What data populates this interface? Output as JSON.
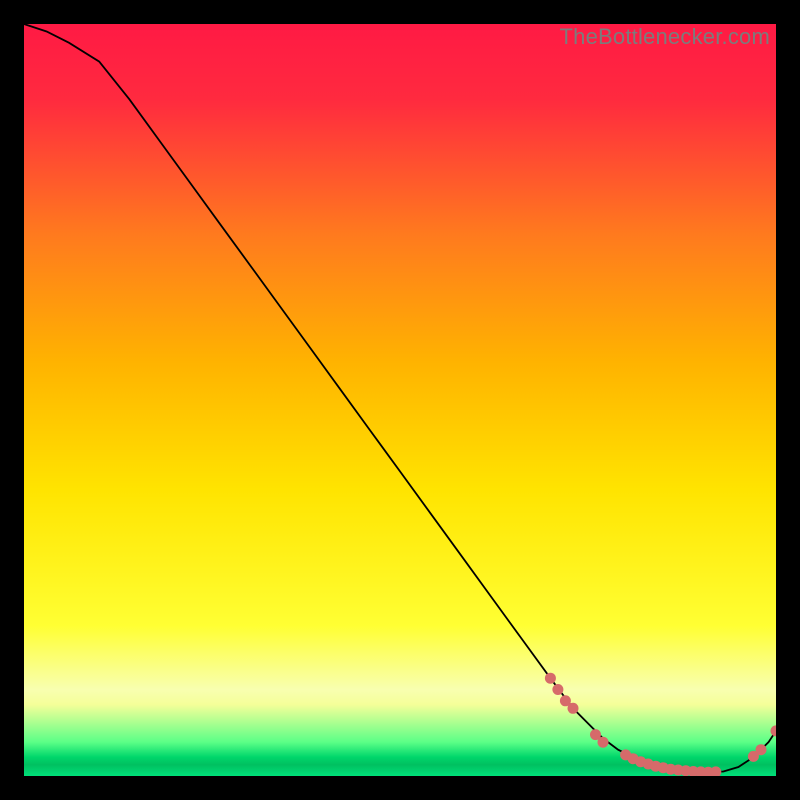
{
  "watermark": "TheBottlenecker.com",
  "chart_data": {
    "type": "line",
    "title": "",
    "xlabel": "",
    "ylabel": "",
    "xlim": [
      0,
      100
    ],
    "ylim": [
      0,
      100
    ],
    "background_gradient": {
      "top": "#ff1a44",
      "mid_top": "#ff9a00",
      "mid": "#ffe400",
      "mid_low": "#ffff66",
      "low_band_top": "#f5ff99",
      "green": "#00d66b"
    },
    "series": [
      {
        "name": "bottleneck-curve",
        "x": [
          0,
          3,
          6,
          10,
          14,
          18,
          22,
          26,
          30,
          34,
          38,
          42,
          46,
          50,
          54,
          58,
          62,
          66,
          70,
          73,
          75,
          77,
          79,
          81,
          83,
          85,
          87,
          89,
          91,
          93,
          95,
          97,
          99,
          100
        ],
        "y": [
          100,
          99,
          97.5,
          95,
          90,
          84.5,
          79,
          73.5,
          68,
          62.5,
          57,
          51.5,
          46,
          40.5,
          35,
          29.5,
          24,
          18.5,
          13,
          9,
          7,
          5,
          3.5,
          2.5,
          1.8,
          1.2,
          0.8,
          0.6,
          0.5,
          0.6,
          1.2,
          2.5,
          4.5,
          6
        ]
      },
      {
        "name": "marker-cluster",
        "type": "scatter",
        "points_xy": [
          [
            70,
            13
          ],
          [
            71,
            11.5
          ],
          [
            72,
            10
          ],
          [
            73,
            9
          ],
          [
            76,
            5.5
          ],
          [
            77,
            4.5
          ],
          [
            80,
            2.8
          ],
          [
            81,
            2.3
          ],
          [
            82,
            1.9
          ],
          [
            83,
            1.6
          ],
          [
            84,
            1.3
          ],
          [
            85,
            1.1
          ],
          [
            86,
            0.9
          ],
          [
            87,
            0.8
          ],
          [
            88,
            0.7
          ],
          [
            89,
            0.6
          ],
          [
            90,
            0.55
          ],
          [
            91,
            0.5
          ],
          [
            92,
            0.55
          ],
          [
            97,
            2.6
          ],
          [
            98,
            3.5
          ],
          [
            100,
            6
          ]
        ]
      }
    ]
  }
}
